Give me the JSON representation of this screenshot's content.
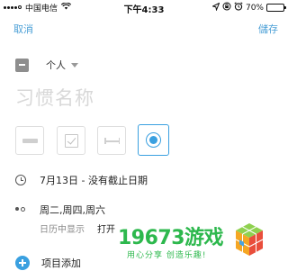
{
  "status_bar": {
    "carrier": "中国电信",
    "time": "下午4:33",
    "battery": "70%",
    "battery_level": 0.7,
    "icons": [
      "signal-icon",
      "wifi-icon",
      "location-icon",
      "lock-rotation-icon",
      "alarm-icon",
      "battery-icon"
    ]
  },
  "nav": {
    "cancel_label": "取消",
    "save_label": "儲存"
  },
  "category": {
    "label": "个人",
    "swatch_color": "#8e8e8e"
  },
  "habit_name": {
    "placeholder": "习惯名称"
  },
  "habit_types": [
    {
      "icon": "bar-icon",
      "selected": false
    },
    {
      "icon": "checkbox-icon",
      "selected": false
    },
    {
      "icon": "range-icon",
      "selected": false
    },
    {
      "icon": "radio-icon",
      "selected": true
    }
  ],
  "schedule": {
    "date_text": "7月13日 - 没有截止日期",
    "days_text": "周二,周四,周六",
    "calendar_label": "日历中显示",
    "calendar_value": "打开"
  },
  "add_item": {
    "label": "项目添加"
  },
  "watermark": {
    "title": "19673游戏",
    "subtitle": "用心分享 创造乐趣!"
  },
  "colors": {
    "accent": "#3aa0e0",
    "link": "#4a9fd6",
    "placeholder": "#d8d8d8",
    "watermark": "#2db84d"
  }
}
